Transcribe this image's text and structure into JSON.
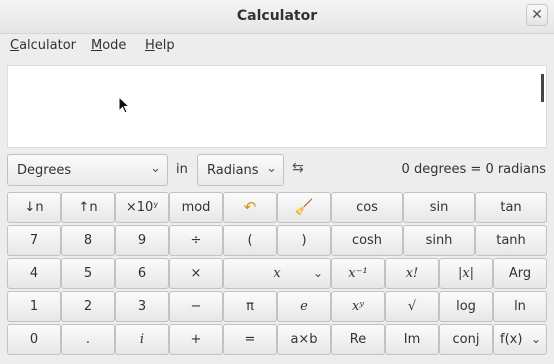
{
  "window": {
    "title": "Calculator",
    "close_glyph": "✕"
  },
  "menubar": {
    "items": [
      "Calculator",
      "Mode",
      "Help"
    ],
    "mnemonics": [
      "C",
      "M",
      "H"
    ]
  },
  "display": {
    "value": ""
  },
  "conversion": {
    "from_unit": "Degrees",
    "in_label": "in",
    "to_unit": "Radians",
    "swap_icon": "⇆",
    "result": "0 degrees = 0 radians"
  },
  "keypad": {
    "rows": [
      [
        "↓n",
        "↑n",
        "×10ʸ",
        "mod",
        "undo-icon",
        "clear-icon",
        "cos",
        "sin",
        "tan"
      ],
      [
        "7",
        "8",
        "9",
        "÷",
        "(",
        ")",
        "cosh",
        "sinh",
        "tanh"
      ],
      [
        "4",
        "5",
        "6",
        "×",
        "x",
        "x⁻¹",
        "x!",
        "|x|",
        "Arg"
      ],
      [
        "1",
        "2",
        "3",
        "−",
        "π",
        "e",
        "xʸ",
        "√",
        "log",
        "ln"
      ],
      [
        "0",
        ".",
        "i",
        "+",
        "=",
        "a×b",
        "Re",
        "Im",
        "conj",
        "f(x)"
      ]
    ],
    "undo_glyph": "↶",
    "clear_glyph": "🧹",
    "chevron_glyph": "⌄"
  }
}
